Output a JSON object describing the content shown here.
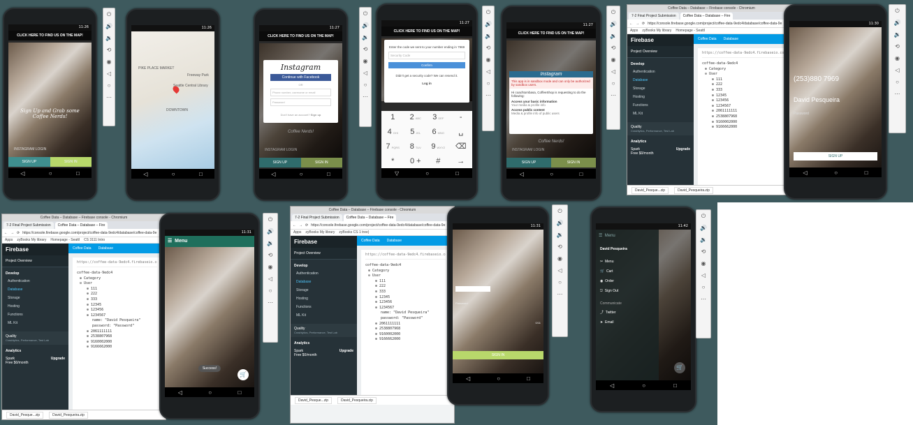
{
  "status_times": {
    "p1": "11:26",
    "p2": "11:26",
    "p3": "11:27",
    "p4": "11:27",
    "p5": "11:27",
    "p6": "11:30",
    "p7": "11:31",
    "p8": "11:31",
    "p9": "11:42"
  },
  "find_map_banner": "CLICK HERE TO FIND US ON THE MAP!",
  "tagline": "Sign Up and Grab some Coffee Nerds!",
  "tagline_short": "Coffee Nerds!",
  "instagram_login": "INSTAGRAM LOGIN",
  "sign_up": "SIGN UP",
  "sign_in": "SIGN IN",
  "map": {
    "labels": [
      "PIKE PLACE MARKET",
      "DOWNTOWN",
      "Seattle Central Library",
      "Freeway Park"
    ]
  },
  "instagram_dialog": {
    "title": "Instagram",
    "fb_button": "Continue with Facebook",
    "or": "OR",
    "username_placeholder": "Phone number, username or email",
    "password_placeholder": "Password",
    "no_account": "Don't have an account?",
    "signup_link": "Sign up"
  },
  "code_dialog": {
    "prompt": "Enter the code we sent to your number ending in",
    "number_tail": "7969",
    "placeholder": "Security Code",
    "confirm": "Confirm",
    "resend": "Didn't get a security code? We can resend it.",
    "login_link": "Log in"
  },
  "keypad": [
    {
      "d": "1",
      "l": ""
    },
    {
      "d": "2",
      "l": "ABC"
    },
    {
      "d": "3",
      "l": "DEF"
    },
    {
      "d": "-",
      "l": ""
    },
    {
      "d": "4",
      "l": "GHI"
    },
    {
      "d": "5",
      "l": "JKL"
    },
    {
      "d": "6",
      "l": "MNO"
    },
    {
      "d": "␣",
      "l": ""
    },
    {
      "d": "7",
      "l": "PQRS"
    },
    {
      "d": "8",
      "l": "TUV"
    },
    {
      "d": "9",
      "l": "WXYZ"
    },
    {
      "d": "⌫",
      "l": ""
    },
    {
      "d": "*",
      "l": ""
    },
    {
      "d": "0 +",
      "l": ""
    },
    {
      "d": "#",
      "l": ""
    },
    {
      "d": "→",
      "l": ""
    }
  ],
  "auth_dialog": {
    "title": "Instagram",
    "warning": "This app is in sandbox mode and can only be authorized by sandbox users.",
    "app_line": "Hi coachtombasa, CoffeeShop is requesting to do the following:",
    "perm1": "Access your basic information",
    "perm1_sub": "Your media & profile info",
    "perm2": "Access public content",
    "perm2_sub": "Media & profile info of public users"
  },
  "browser": {
    "window_title": "Coffee Data – Database – Firebase console - Chromium",
    "tab1": "7-2 Final Project Submission",
    "tab2": "Coffee Data – Database – Fire",
    "url": "https://console.firebase.google.com/project/coffee-data-9edc4/database/coffee-data-9e",
    "bookmarks": [
      "Apps",
      "zyBooks My library",
      "Homepage - Seattl",
      "CS 3111 Intro",
      "zyBooks CS 1 tree)"
    ]
  },
  "firebase": {
    "brand": "Firebase",
    "project": "Project Overview",
    "develop": "Develop",
    "items": [
      "Authentication",
      "Database",
      "Storage",
      "Hosting",
      "Functions",
      "ML Kit"
    ],
    "quality": "Quality",
    "quality_sub": "Crashlytics, Performance, Test Lab",
    "analytics": "Analytics",
    "plan": "Spark",
    "plan_sub": "Free $0/month",
    "upgrade": "Upgrade",
    "crumb1": "Coffee Data",
    "crumb2": "Database",
    "db_url": "https://coffee-data-9edc4.firebaseio.com/",
    "root": "coffee-data-9edc4",
    "category": "Category",
    "user": "User",
    "ids": [
      "111",
      "222",
      "333",
      "12345",
      "123456",
      "1234567",
      "2061111111",
      "2538807968",
      "9160002000",
      "9166662000"
    ],
    "name_field": "name: \"David Pesqueira\"",
    "password_field": "password: \"Password\""
  },
  "downloads": [
    "David_Pesque...zip",
    "David_Pesqueira.zip"
  ],
  "signup_screen": {
    "phone": "(253)880 7969",
    "name": "David Pesqueira",
    "password_hint": "Password",
    "button": "SIGN UP"
  },
  "menu_screen": {
    "title": "Menu",
    "toast": "Success!"
  },
  "drawer": {
    "title": "Menu",
    "user": "David Pesqueira",
    "items": [
      "Menu",
      "Cart",
      "Order",
      "Sign Out"
    ],
    "section": "Communicate",
    "comm": [
      "Twitter",
      "Email"
    ]
  },
  "counter": "0/11",
  "signin_label": "SIGN IN"
}
